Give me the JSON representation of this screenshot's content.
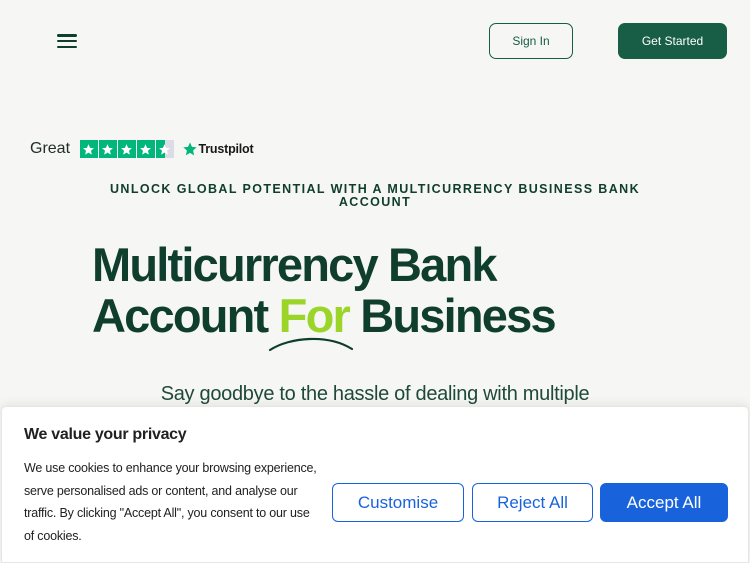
{
  "header": {
    "menu_icon": "hamburger-menu-icon",
    "signin_label": "Sign In",
    "get_started_label": "Get Started"
  },
  "trustpilot": {
    "rating_label": "Great",
    "stars_filled": 4.5,
    "stars_total": 5,
    "brand": "Trustpilot",
    "star_color": "#00b67a"
  },
  "hero": {
    "eyebrow": "UNLOCK GLOBAL POTENTIAL WITH A MULTICURRENCY BUSINESS BANK ACCOUNT",
    "title_line1": "Multicurrency Bank",
    "title_line2_start": "Account ",
    "title_accent": "For",
    "title_line2_end": " Business",
    "subtitle": "Say goodbye to the hassle of dealing with multiple",
    "accent_color": "#9bd52a"
  },
  "cookie_banner": {
    "title": "We value your privacy",
    "body": "We use cookies to enhance your browsing experience, serve personalised ads or content, and analyse our traffic. By clicking \"Accept All\", you consent to our use of cookies.",
    "customise_label": "Customise",
    "reject_label": "Reject All",
    "accept_label": "Accept All",
    "button_color": "#1863dc"
  },
  "colors": {
    "brand_green": "#185e47",
    "background": "#f6f6f4"
  }
}
